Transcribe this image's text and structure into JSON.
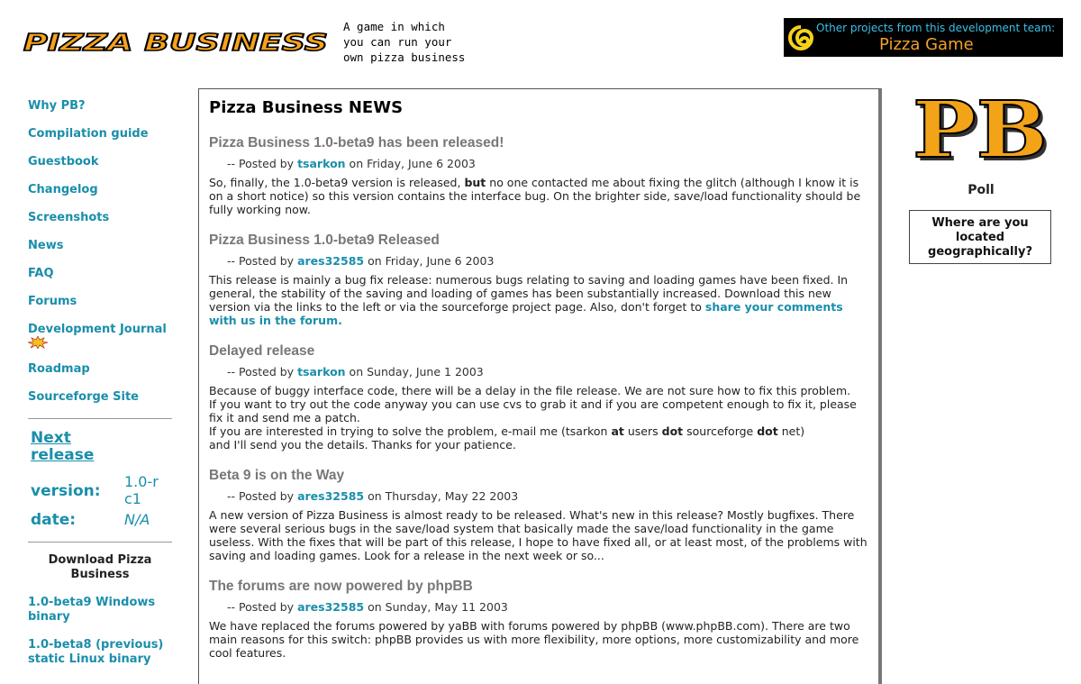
{
  "header": {
    "logo_text": "PIZZA BUSINESS",
    "tagline": [
      "A game in which",
      "you can run your",
      "own pizza business"
    ],
    "banner": {
      "line1": "Other projects from this development team:",
      "line2": "Pizza Game"
    }
  },
  "nav": {
    "items": [
      {
        "label": "Why PB?"
      },
      {
        "label": "Compilation guide"
      },
      {
        "label": "Guestbook"
      },
      {
        "label": "Changelog"
      },
      {
        "label": "Screenshots"
      },
      {
        "label": "News"
      },
      {
        "label": "FAQ"
      },
      {
        "label": "Forums"
      },
      {
        "label": "Development Journal"
      },
      {
        "label": "Roadmap"
      },
      {
        "label": "Sourceforge Site"
      }
    ]
  },
  "next_release": {
    "link": "Next release",
    "version_label": "version:",
    "version_value": "1.0-rc1",
    "date_label": "date:",
    "date_value": "N/A"
  },
  "downloads": {
    "title": "Download Pizza Business",
    "items": [
      {
        "label": "1.0-beta9 Windows binary"
      },
      {
        "label": "1.0-beta8 (previous) static Linux binary"
      }
    ]
  },
  "news": {
    "title": "Pizza Business NEWS",
    "posted_by": "-- Posted by",
    "on": "on",
    "posts": [
      {
        "title": "Pizza Business 1.0-beta9 has been released!",
        "author": "tsarkon",
        "date": "Friday, June 6 2003",
        "body_a": "So, finally, the 1.0-beta9 version is released,",
        "body_bold": "but",
        "body_b": "no one contacted me about fixing the glitch (although I know it is on a short notice) so this version contains the interface bug. On the brighter side, save/load functionality should be fully working now."
      },
      {
        "title": "Pizza Business 1.0-beta9 Released",
        "author": "ares32585",
        "date": "Friday, June 6 2003",
        "body_a": "This release is mainly a bug fix release: numerous bugs relating to saving and loading games have been fixed. In general, the stability of the saving and loading of games has been substantially increased. Download this new version via the links to the left or via the sourceforge project page. Also, don't forget to",
        "link": "share your comments with us in the forum."
      },
      {
        "title": "Delayed release",
        "author": "tsarkon",
        "date": "Sunday, June 1 2003",
        "line1": "Because of buggy interface code, there will be a delay in the file release. We are not sure how to fix this problem.",
        "line2": "If you want to try out the code anyway you can use cvs to grab it and if you are competent enough to fix it, please fix it and send me a patch.",
        "line3a": "If you are interested in trying to solve the problem, e-mail me (tsarkon",
        "at": "at",
        "line3b": "users",
        "dot1": "dot",
        "line3c": "sourceforge",
        "dot2": "dot",
        "line3d": "net)",
        "line4": "and I'll send you the details. Thanks for your patience."
      },
      {
        "title": "Beta 9 is on the Way",
        "author": "ares32585",
        "date": "Thursday, May 22 2003",
        "body_a": "A new version of Pizza Business is almost ready to be released. What's new in this release? Mostly bugfixes. There were several serious bugs in the save/load system that basically made the save/load functionality in the game useless. With the fixes that will be part of this release, I hope to have fixed all, or at least most, of the problems with saving and loading games. Look for a release in the next week or so..."
      },
      {
        "title": "The forums are now powered by phpBB",
        "author": "ares32585",
        "date": "Sunday, May 11 2003",
        "body_a": "We have replaced the forums powered by yaBB with forums powered by phpBB (www.phpBB.com). There are two main reasons for this switch: phpBB provides us with more flexibility, more options, more customizability and more cool features."
      }
    ]
  },
  "right": {
    "logo_text": "PB",
    "poll_title": "Poll",
    "poll_question": "Where are you located geographically?"
  },
  "colors": {
    "link": "#1a8eab",
    "post_title": "#777777",
    "logo_orange": "#f7a21b",
    "banner_bg": "#000000"
  }
}
